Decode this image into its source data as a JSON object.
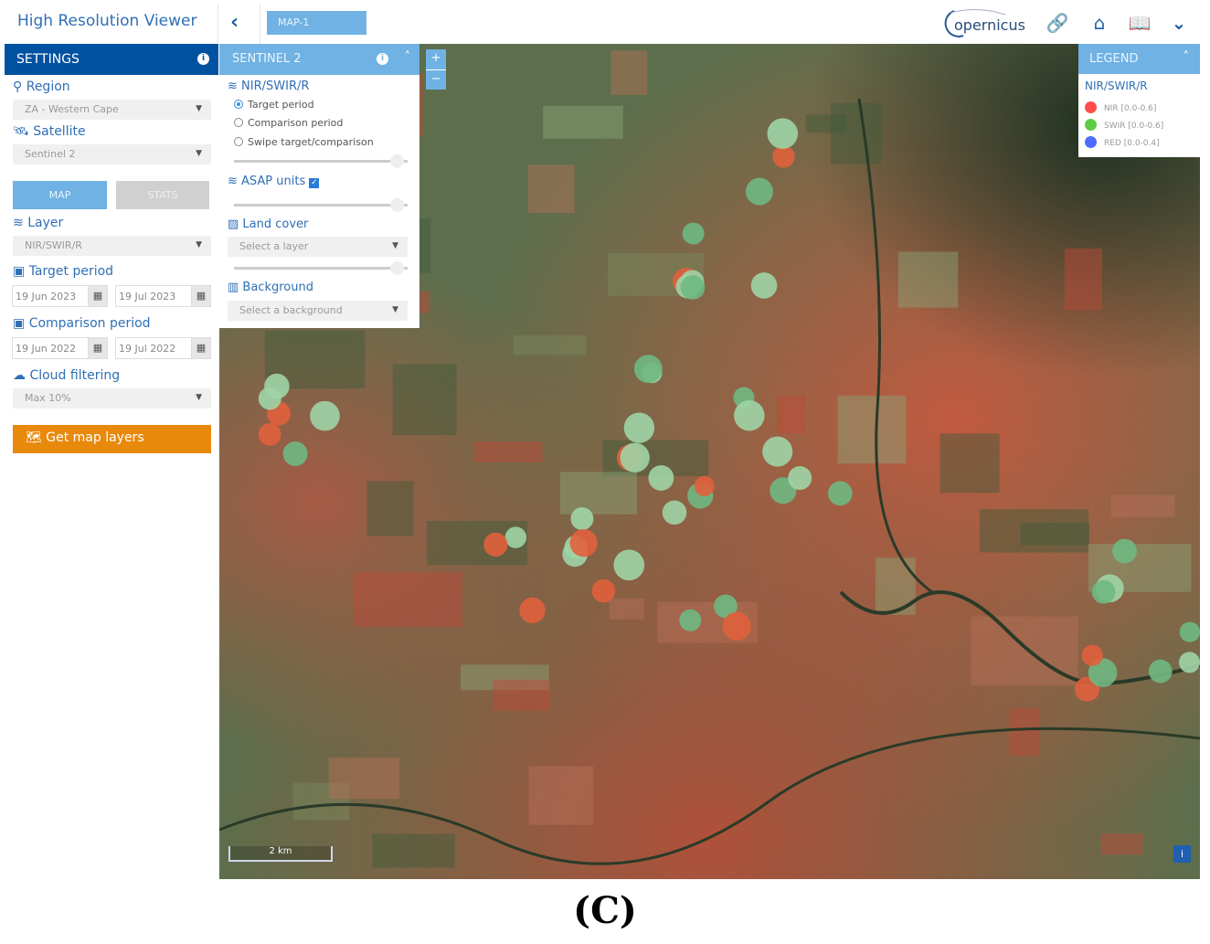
{
  "header": {
    "title": "High Resolution Viewer",
    "back_icon": "chevron-left",
    "map_tab": "MAP-1",
    "logo": "opernicus",
    "icons": [
      "link-icon",
      "home-icon",
      "reader-icon",
      "chevron-down-icon"
    ]
  },
  "settings": {
    "title": "SETTINGS",
    "region": {
      "label": "Region",
      "value": "ZA - Western Cape"
    },
    "satellite": {
      "label": "Satellite",
      "value": "Sentinel 2"
    },
    "tabs": {
      "map": "MAP",
      "stats": "STATS"
    },
    "layer": {
      "label": "Layer",
      "value": "NIR/SWIR/R"
    },
    "target": {
      "label": "Target period",
      "from": "19 Jun 2023",
      "to": "19 Jul 2023"
    },
    "comparison": {
      "label": "Comparison period",
      "from": "19 Jun 2022",
      "to": "19 Jul 2022"
    },
    "cloud": {
      "label": "Cloud filtering",
      "value": "Max 10%"
    },
    "get_button": "Get map layers"
  },
  "sentinel": {
    "title": "SENTINEL 2",
    "layer_label": "NIR/SWIR/R",
    "radios": [
      {
        "label": "Target period",
        "checked": true
      },
      {
        "label": "Comparison period",
        "checked": false
      },
      {
        "label": "Swipe target/comparison",
        "checked": false
      }
    ],
    "asap_label": "ASAP units",
    "asap_checked": true,
    "landcover_label": "Land cover",
    "landcover_placeholder": "Select a layer",
    "background_label": "Background",
    "background_placeholder": "Select a background"
  },
  "zoom": {
    "in": "+",
    "out": "−"
  },
  "legend": {
    "title": "LEGEND",
    "layer": "NIR/SWIR/R",
    "items": [
      {
        "label": "NIR [0.0-0.6]",
        "color": "#ff4d4d"
      },
      {
        "label": "SWIR [0.0-0.6]",
        "color": "#5fcc45"
      },
      {
        "label": "RED [0.0-0.4]",
        "color": "#4d6bff"
      }
    ]
  },
  "map": {
    "scale": "2 km",
    "info": "i"
  },
  "caption": "(C)"
}
